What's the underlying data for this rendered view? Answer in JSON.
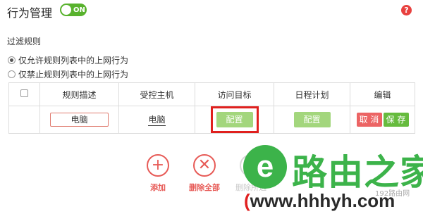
{
  "header": {
    "title": "行为管理",
    "toggle_label": "ON",
    "help_label": "?"
  },
  "filter": {
    "section_title": "过滤规则",
    "options": [
      {
        "label": "仅允许规则列表中的上网行为",
        "selected": true
      },
      {
        "label": "仅禁止规则列表中的上网行为",
        "selected": false
      }
    ]
  },
  "table": {
    "headers": [
      "规则描述",
      "受控主机",
      "访问目标",
      "日程计划",
      "编辑"
    ],
    "row": {
      "description": "电脑",
      "host": "电脑",
      "target_button": "配置",
      "schedule_button": "配置",
      "cancel_button": "取 消",
      "save_button": "保 存"
    }
  },
  "actions": [
    {
      "label": "添加",
      "icon": "plus-icon",
      "symbol": "+"
    },
    {
      "label": "删除全部",
      "icon": "close-icon",
      "symbol": "✕"
    },
    {
      "label": "删除所选",
      "icon": "close-icon",
      "symbol": "✕"
    }
  ],
  "watermark": {
    "logo_letter": "e",
    "name": "路由之家",
    "url_open": "(",
    "url_domain": "www.hhhyh.com",
    "small": "192路由网"
  },
  "colors": {
    "toggle_on": "#58b22d",
    "help": "#e8413f",
    "config_button": "#a3d67d",
    "cancel_button": "#ec6464",
    "save_button": "#66bb3e",
    "highlight_border": "#e0201e",
    "action_red": "#e75b57",
    "watermark_green": "#3cb34a"
  }
}
